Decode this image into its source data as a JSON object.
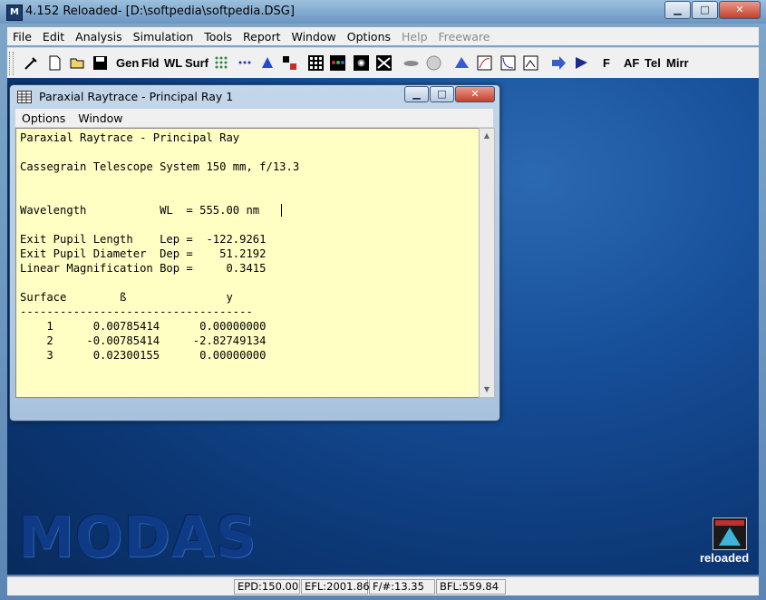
{
  "window": {
    "title": "4.152 Reloaded- [D:\\softpedia\\softpedia.DSG]",
    "minimize_label": "▁",
    "maximize_label": "□",
    "close_label": "✕"
  },
  "menubar": {
    "items": [
      "File",
      "Edit",
      "Analysis",
      "Simulation",
      "Tools",
      "Report",
      "Window",
      "Options",
      "Help",
      "Freeware"
    ]
  },
  "toolbar": {
    "text_buttons": [
      "Gen",
      "Fld",
      "WL",
      "Surf",
      "F",
      "AF",
      "Tel",
      "Mirr"
    ]
  },
  "child_window": {
    "title": "Paraxial Raytrace - Principal Ray 1",
    "menu": [
      "Options",
      "Window"
    ],
    "lines": [
      "Paraxial Raytrace - Principal Ray",
      "",
      "Cassegrain Telescope System 150 mm, f/13.3",
      "",
      "",
      "Wavelength           WL  = 555.00 nm",
      "",
      "Exit Pupil Length    Lep =  -122.9261",
      "Exit Pupil Diameter  Dep =    51.2192",
      "Linear Magnification Bop =     0.3415",
      "",
      "Surface        ß               y",
      "-----------------------------------",
      "    1      0.00785414      0.00000000",
      "    2     -0.00785414     -2.82749134",
      "    3      0.02300155      0.00000000"
    ]
  },
  "desktop": {
    "brand": "MODAS",
    "reloaded_label": "reloaded"
  },
  "statusbar": {
    "epd": "EPD:150.00",
    "efl": "EFL:2001.86",
    "fnum": "F/#:13.35",
    "bfl": "BFL:559.84"
  },
  "colors": {
    "desktop_blue": "#164e98",
    "text_area_bg": "#ffffc4",
    "menu_bg": "#f0f0f0"
  }
}
